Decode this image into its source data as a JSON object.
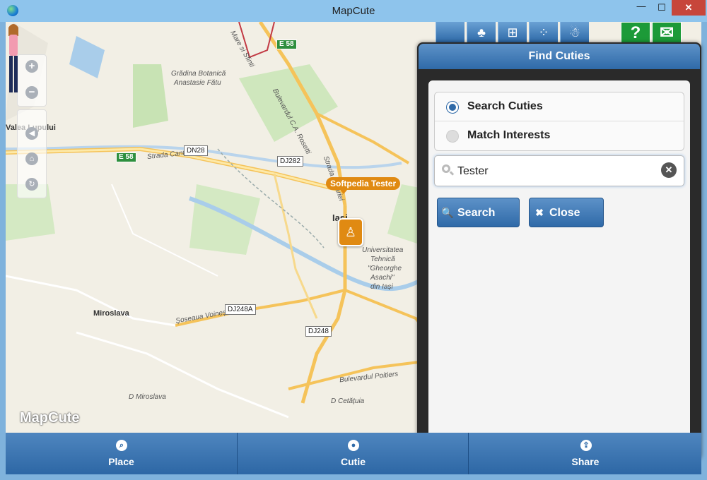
{
  "window": {
    "title": "MapCute",
    "minimize": "—",
    "maximize": "☐",
    "close": "✕"
  },
  "map": {
    "watermark": "MapCute",
    "labels": {
      "gradina": "Grădina Botanică",
      "gradina2": "Anastasie Fătu",
      "valea": "Valea Lupului",
      "strada_canta": "Strada Canta",
      "bulevardul": "Bulevardul C.A. Rosetti",
      "strada_sarii": "Strada Sărăriei",
      "stanci": "Mare si Sfinti",
      "iasi": "Iași",
      "univ1": "Universitatea",
      "univ2": "Tehnică",
      "univ3": "\"Gheorghe",
      "univ4": "Asachi\"",
      "univ5": "din Iași",
      "miroslava": "Miroslava",
      "soseaua": "Șoseaua Voinești",
      "d_miroslava": "D Miroslava",
      "bulevardul_poitiers": "Bulevardul Poitiers",
      "cetatuia": "D Cetățuia"
    },
    "shields": {
      "dn28": "DN28",
      "dj282": "DJ282",
      "dj248a": "DJ248A",
      "dj248": "DJ248",
      "e58a": "E 58",
      "e58b": "E 58"
    },
    "callout": "Softpedia Tester"
  },
  "zoom": {
    "in": "+",
    "out": "−"
  },
  "nav": {
    "back": "◀",
    "home": "⌂",
    "refresh": "↻"
  },
  "top_icons": {
    "apple": "",
    "android": "♣",
    "windows": "⊞",
    "blackberry": "⁘",
    "linux": "☃",
    "help": "?",
    "mail": "✉"
  },
  "panel": {
    "title": "Find Cuties",
    "options": [
      "Search Cuties",
      "Match Interests"
    ],
    "search": {
      "value": "Tester",
      "clear": "✕"
    },
    "buttons": {
      "search": "Search",
      "close": "Close",
      "search_icon": "🔍",
      "close_icon": "✖"
    }
  },
  "tabs": [
    {
      "label": "Place",
      "icon": "⌕"
    },
    {
      "label": "Cutie",
      "icon": "●"
    },
    {
      "label": "Share",
      "icon": "⇪"
    }
  ]
}
